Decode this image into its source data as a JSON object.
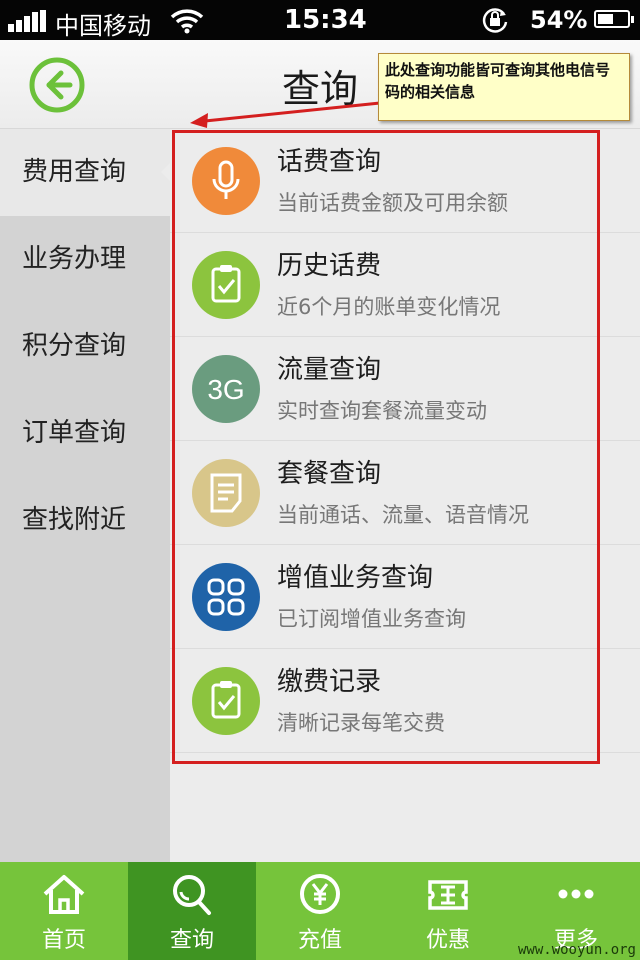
{
  "status_bar": {
    "carrier": "中国移动",
    "time": "15:34",
    "battery_percent_label": "54%",
    "battery_level": 0.54
  },
  "header": {
    "title": "查询"
  },
  "annotation": {
    "text": "此处查询功能皆可查询其他电信号码的相关信息"
  },
  "sidebar": {
    "items": [
      {
        "label": "费用查询",
        "active": true
      },
      {
        "label": "业务办理"
      },
      {
        "label": "积分查询"
      },
      {
        "label": "订单查询"
      },
      {
        "label": "查找附近"
      }
    ]
  },
  "list": {
    "items": [
      {
        "title": "话费查询",
        "desc": "当前话费金额及可用余额",
        "icon": "microphone-icon",
        "color": "#f08a3a"
      },
      {
        "title": "历史话费",
        "desc": "近6个月的账单变化情况",
        "icon": "clipboard-check-icon",
        "color": "#8cc43e"
      },
      {
        "title": "流量查询",
        "desc": "实时查询套餐流量变动",
        "icon": "3g-icon",
        "icon_text": "3G",
        "color": "#6a9c7f"
      },
      {
        "title": "套餐查询",
        "desc": "当前通话、流量、语音情况",
        "icon": "document-icon",
        "color": "#d8c68a"
      },
      {
        "title": "增值业务查询",
        "desc": "已订阅增值业务查询",
        "icon": "grid-apps-icon",
        "color": "#1f63a8"
      },
      {
        "title": "缴费记录",
        "desc": "清晰记录每笔交费",
        "icon": "clipboard-check-icon",
        "color": "#8cc43e"
      }
    ]
  },
  "tabbar": {
    "tabs": [
      {
        "label": "首页",
        "icon": "home-icon"
      },
      {
        "label": "查询",
        "icon": "search-icon",
        "active": true
      },
      {
        "label": "充值",
        "icon": "yuan-coin-icon"
      },
      {
        "label": "优惠",
        "icon": "coupon-icon"
      },
      {
        "label": "更多",
        "icon": "more-dots-icon"
      }
    ]
  },
  "watermark": "www.wooyun.org",
  "colors": {
    "accent_green": "#76c43b",
    "active_tab_green": "#3f9422",
    "annotation_red": "#d41f1f"
  }
}
